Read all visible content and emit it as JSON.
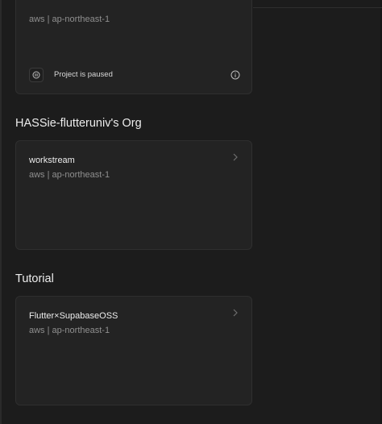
{
  "projects_top": {
    "region": "aws | ap-northeast-1",
    "status_label": "Project is paused"
  },
  "orgs": [
    {
      "name": "HASSie-flutteruniv's Org",
      "projects": [
        {
          "name": "workstream",
          "region": "aws | ap-northeast-1"
        }
      ]
    },
    {
      "name": "Tutorial",
      "projects": [
        {
          "name": "Flutter×SupabaseOSS",
          "region": "aws | ap-northeast-1"
        }
      ]
    }
  ],
  "icons": {
    "pause": "pause-circle-icon",
    "info": "info-icon",
    "chevron": "chevron-right-icon"
  },
  "colors": {
    "background": "#1c1c1c",
    "card": "#232323",
    "card_border": "#2f2f2f",
    "text_primary": "#ededed",
    "text_secondary": "#8f8f8f"
  }
}
